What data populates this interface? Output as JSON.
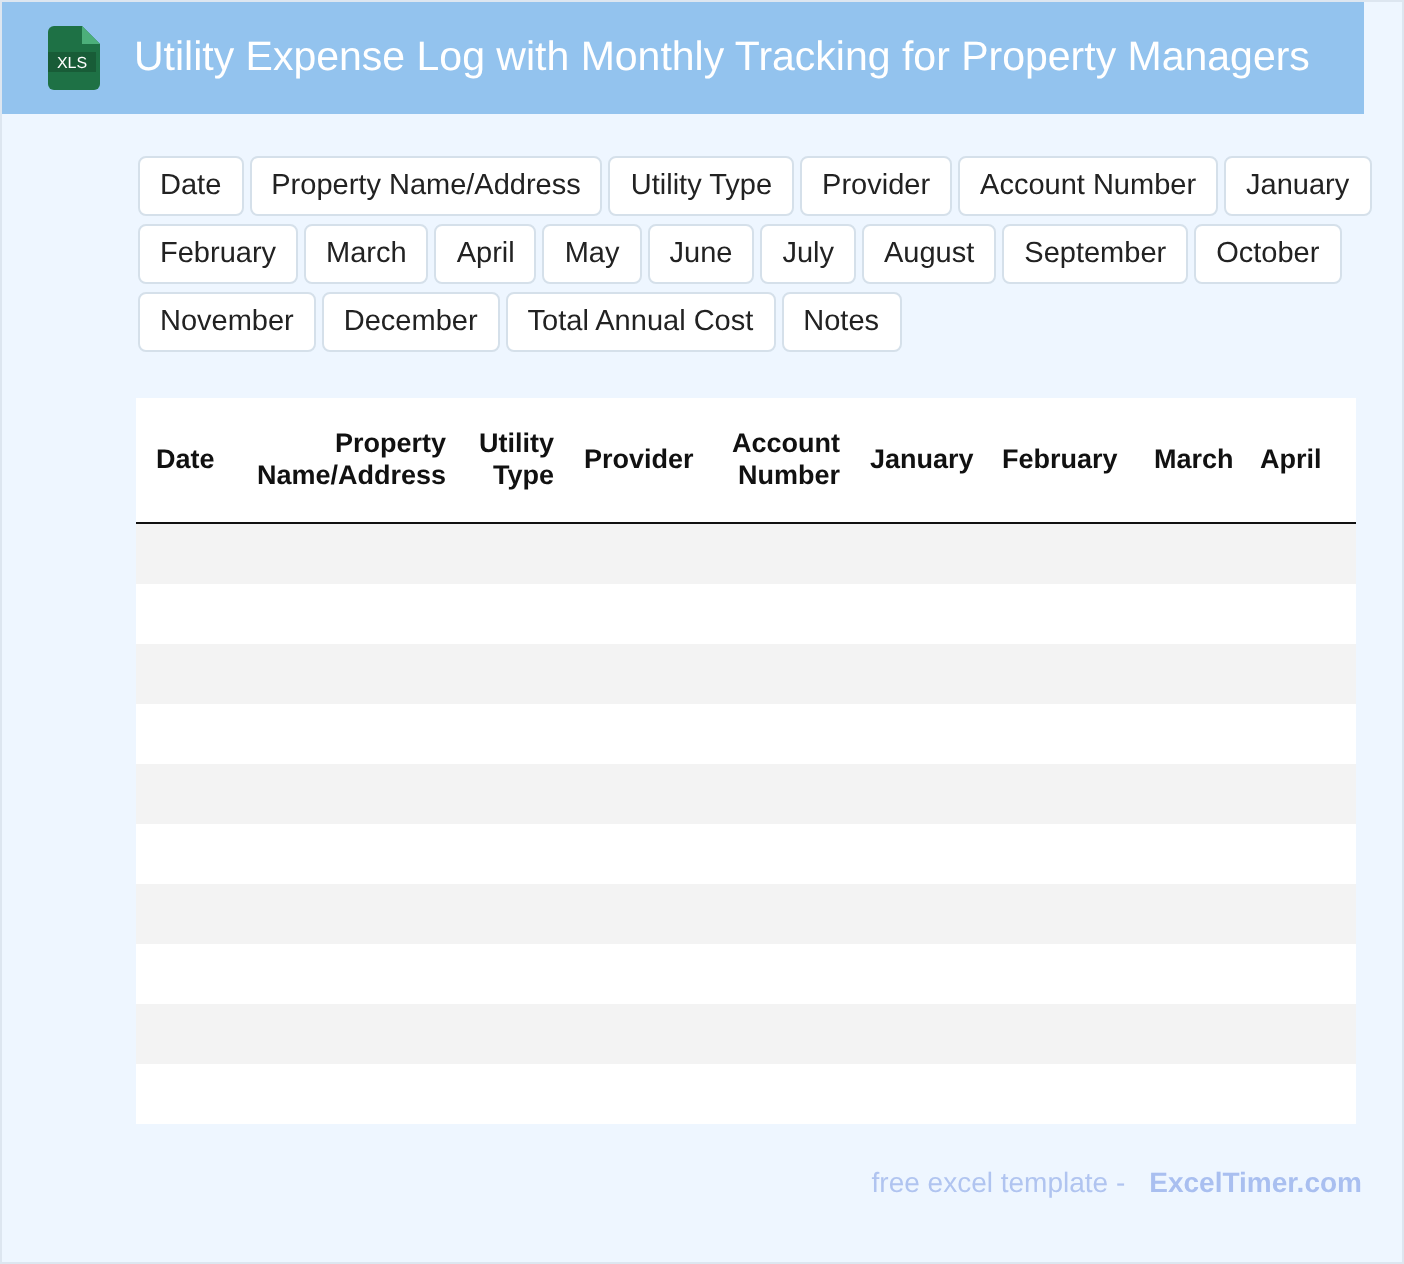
{
  "title": "Utility Expense Log with Monthly Tracking for Property Managers",
  "file_icon_label": "XLS",
  "field_tags": [
    "Date",
    "Property Name/Address",
    "Utility Type",
    "Provider",
    "Account Number",
    "January",
    "February",
    "March",
    "April",
    "May",
    "June",
    "July",
    "August",
    "September",
    "October",
    "November",
    "December",
    "Total Annual Cost",
    "Notes"
  ],
  "table": {
    "columns": [
      "Date",
      "Property Name/Address",
      "Utility Type",
      "Provider",
      "Account Number",
      "January",
      "February",
      "March",
      "April"
    ]
  },
  "footer": {
    "text": "free excel template -",
    "link": "ExcelTimer.com"
  }
}
